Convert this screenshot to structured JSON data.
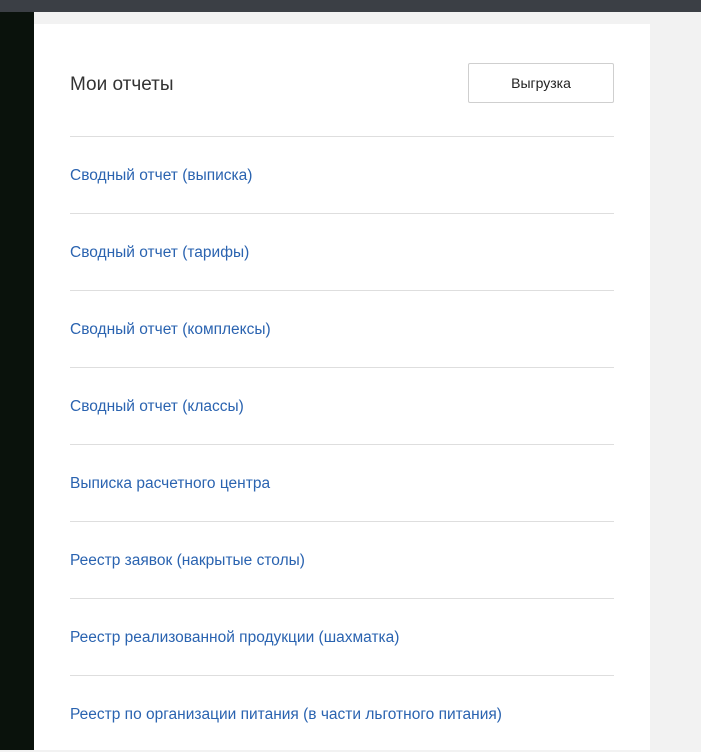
{
  "panel": {
    "title": "Мои отчеты",
    "export_button_label": "Выгрузка"
  },
  "reports": [
    {
      "label": "Сводный отчет (выписка)"
    },
    {
      "label": "Сводный отчет (тарифы)"
    },
    {
      "label": "Сводный отчет (комплексы)"
    },
    {
      "label": "Сводный отчет (классы)"
    },
    {
      "label": "Выписка расчетного центра"
    },
    {
      "label": "Реестр заявок (накрытые столы)"
    },
    {
      "label": "Реестр реализованной продукции (шахматка)"
    },
    {
      "label": "Реестр по организации питания (в части льготного питания)"
    }
  ],
  "colors": {
    "link": "#2a63b0",
    "background": "#f2f2f2",
    "panel": "#ffffff",
    "top_bar": "#3b3f45"
  }
}
